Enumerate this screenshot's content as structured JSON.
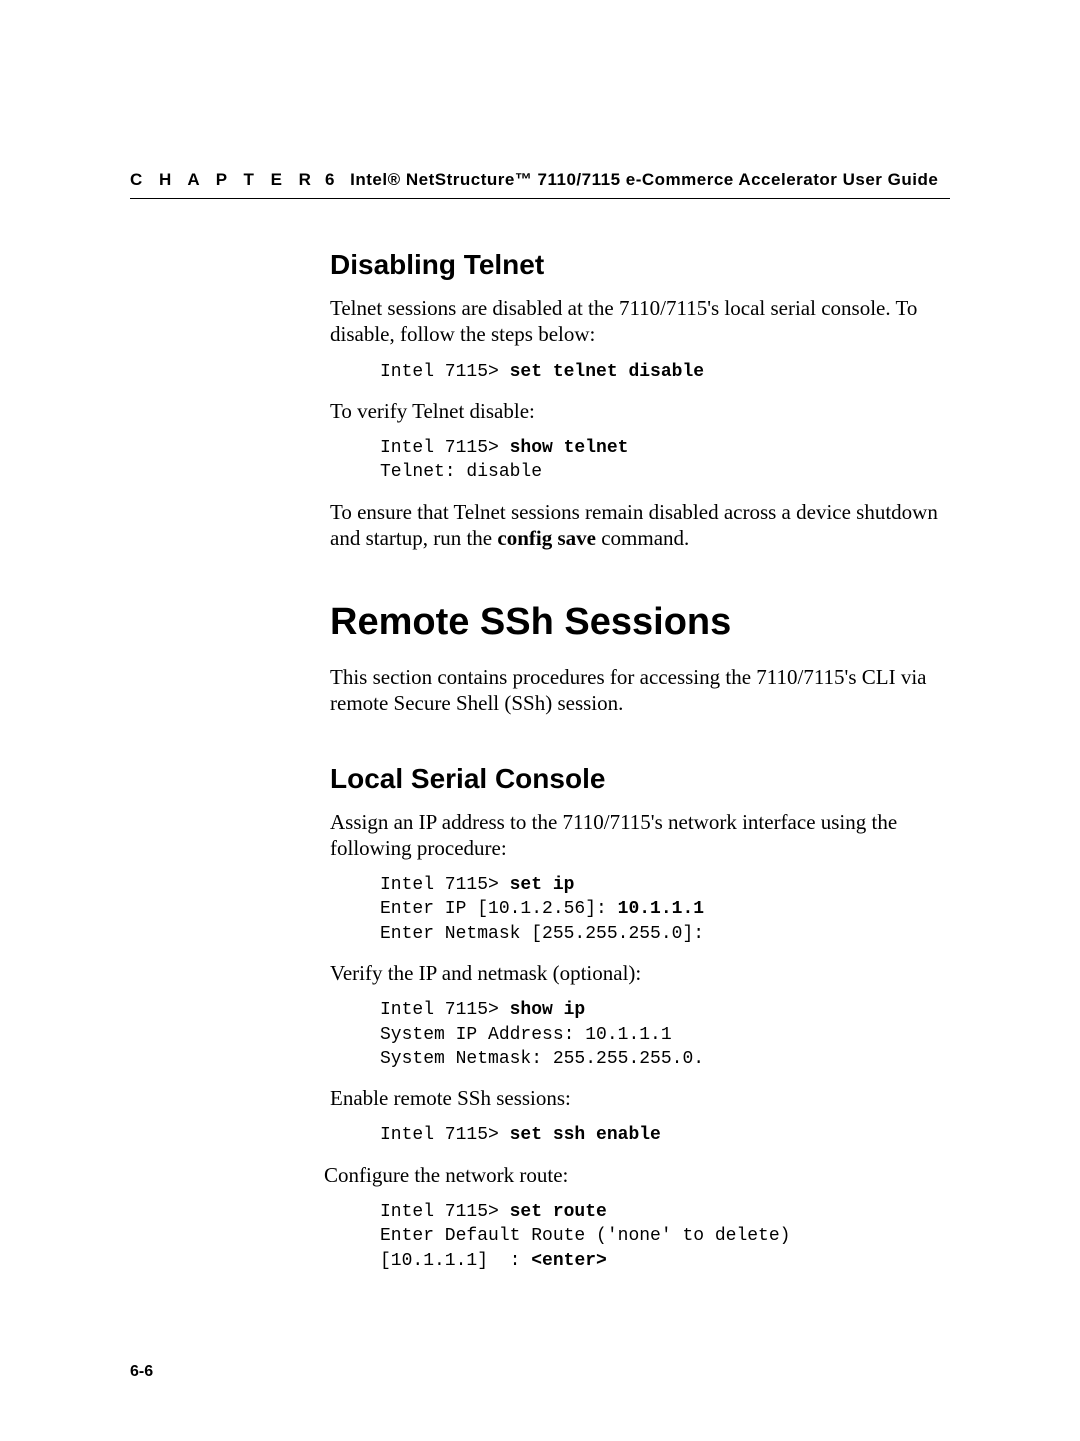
{
  "header": {
    "chapter_label": "C H A P T E R",
    "chapter_num": "6",
    "title": "Intel® NetStructure™ 7110/7115 e-Commerce Accelerator User Guide"
  },
  "sec1": {
    "heading": "Disabling Telnet",
    "p1": "Telnet sessions are disabled at the 7110/7115's local serial console. To disable, follow the steps below:",
    "code1_prompt": "Intel 7115> ",
    "code1_cmd": "set telnet disable",
    "p2": "To verify Telnet disable:",
    "code2_prompt": "Intel 7115> ",
    "code2_cmd": "show telnet",
    "code2_out": "Telnet: disable",
    "p3_a": "To ensure that  Telnet sessions remain disabled across a device shutdown and startup, run the ",
    "p3_b": "config save",
    "p3_c": " command."
  },
  "sec2": {
    "heading": "Remote SSh Sessions",
    "p1": "This section contains procedures for accessing the 7110/7115's CLI via remote Secure Shell (SSh) session."
  },
  "sec3": {
    "heading": "Local Serial Console",
    "p1": "Assign an IP address to the 7110/7115's network interface using the following procedure:",
    "code1_prompt": "Intel 7115> ",
    "code1_cmd": "set ip",
    "code1_l2a": "Enter IP [10.1.2.56]: ",
    "code1_l2b": "10.1.1.1",
    "code1_l3": "Enter Netmask [255.255.255.0]:",
    "p2": "Verify the IP and netmask (optional):",
    "code2_prompt": "Intel 7115> ",
    "code2_cmd": "show ip",
    "code2_l2": "System IP Address: 10.1.1.1",
    "code2_l3": "System Netmask: 255.255.255.0.",
    "p3": "Enable remote SSh sessions:",
    "code3_prompt": "Intel 7115> ",
    "code3_cmd": "set ssh enable",
    "p4": " Configure the network route:",
    "code4_prompt": "Intel 7115> ",
    "code4_cmd": "set route",
    "code4_l2": "Enter Default Route ('none' to delete)",
    "code4_l3a": "[10.1.1.1]  : ",
    "code4_l3b": "<enter>"
  },
  "footer": {
    "page": "6-6"
  }
}
